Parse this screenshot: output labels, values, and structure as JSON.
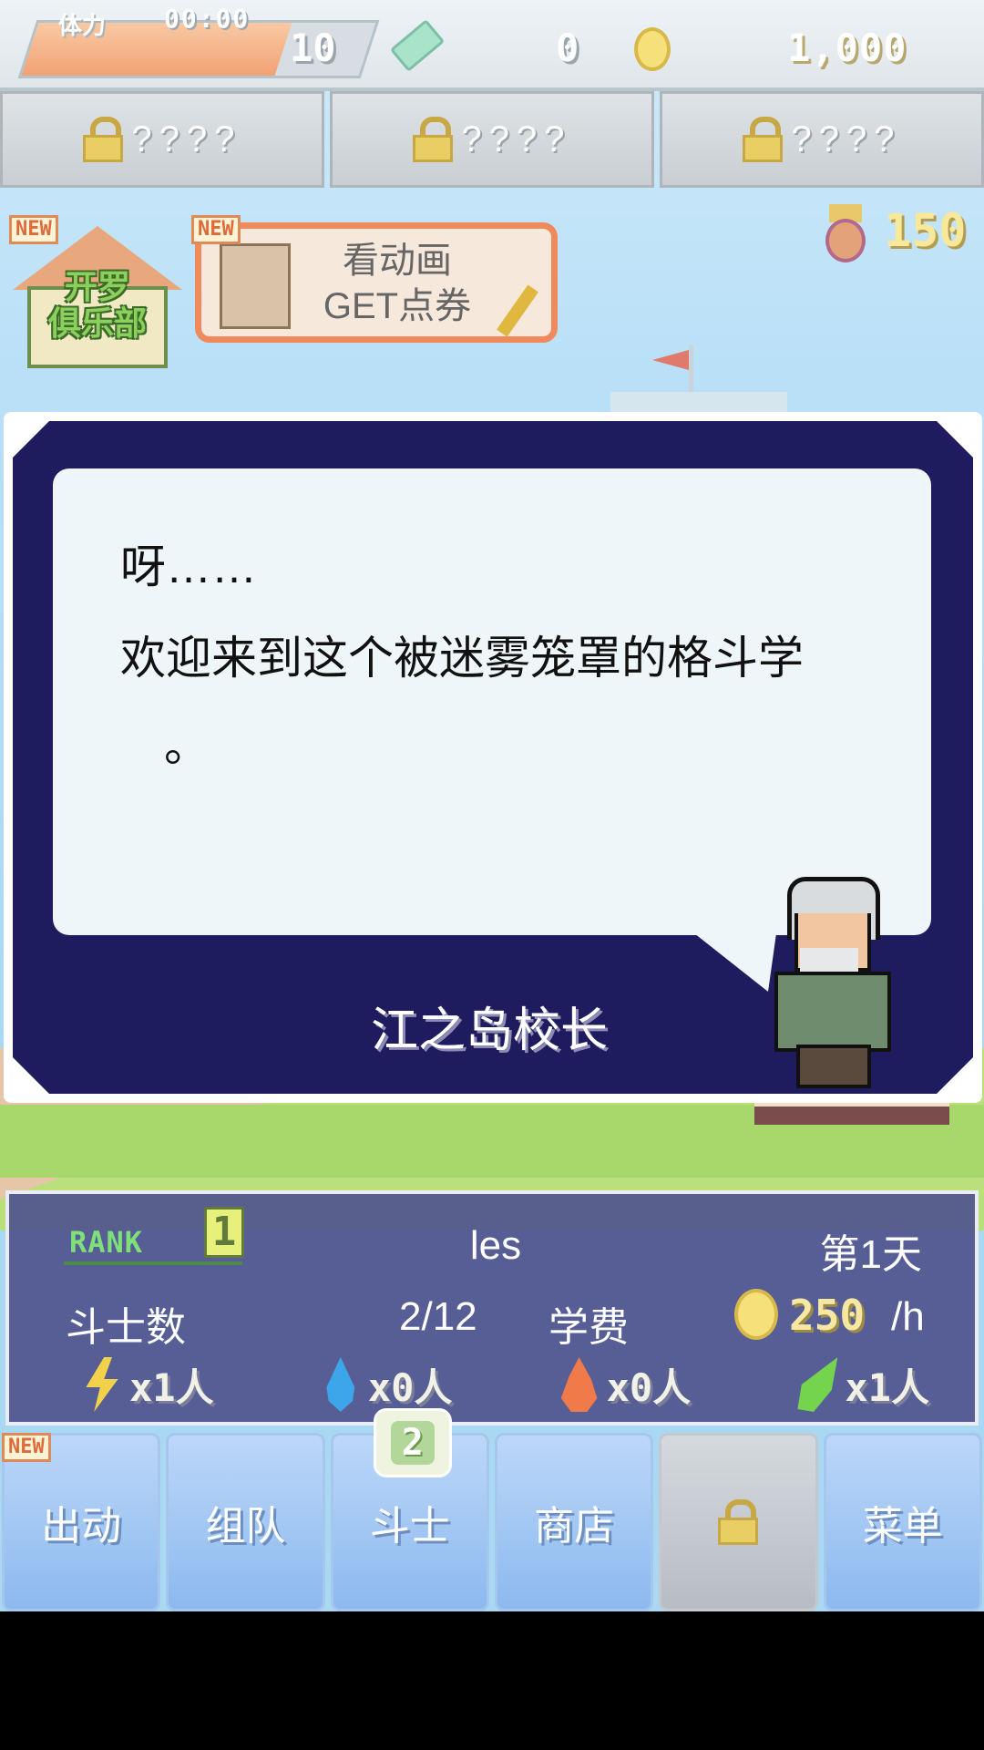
{
  "top_bar": {
    "stamina_label": "体力",
    "stamina_timer": "00:00",
    "stamina_value": "10",
    "stamina_fill": 0.75,
    "tickets": "0",
    "coins": "1,000"
  },
  "locked_slots": [
    {
      "text": "????"
    },
    {
      "text": "????"
    },
    {
      "text": "????"
    }
  ],
  "badges": {
    "new": "NEW"
  },
  "club": {
    "label": "开罗\n俱乐部"
  },
  "watch_anime": {
    "line1": "看动画",
    "line2": "GET点券"
  },
  "medals": "150",
  "dialog": {
    "line1": "呀……",
    "line2": "欢迎来到这个被迷雾笼罩的格斗学",
    "line3": "。",
    "speaker": "江之岛校长"
  },
  "status": {
    "rank_label": "RANK",
    "rank_value": "1",
    "player_name": "les",
    "day": "第1天",
    "fighters_label": "斗士数",
    "fighters_value": "2/12",
    "fee_label": "学费",
    "fee_value": "250",
    "fee_unit": "/h",
    "elements": [
      {
        "icon": "thunder-icon",
        "value": "x1人"
      },
      {
        "icon": "water-drop-icon",
        "value": "x0人"
      },
      {
        "icon": "fire-icon",
        "value": "x0人"
      },
      {
        "icon": "leaf-icon",
        "value": "x1人"
      }
    ]
  },
  "nav": {
    "items": [
      {
        "label": "出动"
      },
      {
        "label": "组队"
      },
      {
        "label": "斗士",
        "badge": "2"
      },
      {
        "label": "商店"
      },
      {
        "label": "",
        "icon": "lock-icon"
      },
      {
        "label": "菜单"
      }
    ]
  },
  "colors": {
    "dialog_frame": "#1e1c5e",
    "status_panel": "#50548e",
    "nav_button": "#8cb9ef",
    "accent_orange": "#f08a5d"
  }
}
